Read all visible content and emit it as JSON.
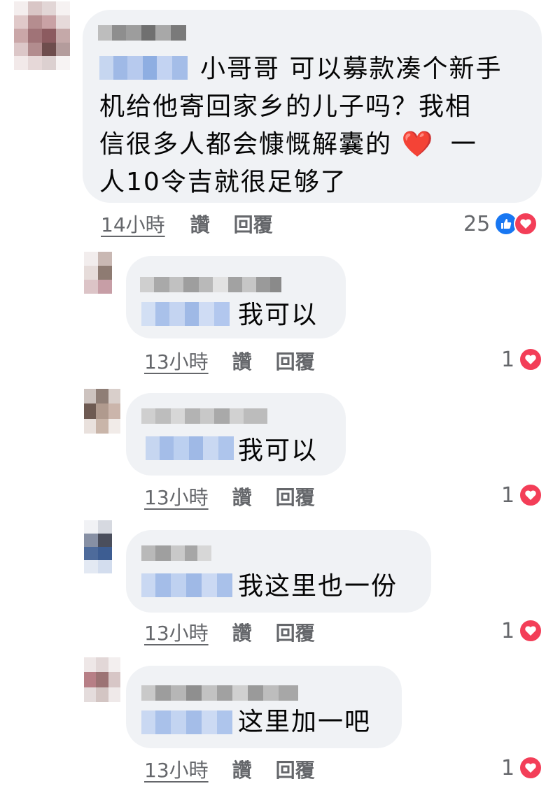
{
  "comments": [
    {
      "text_line1": "小哥哥 可以募款凑个新手",
      "text_line2": "机给他寄回家乡的儿子吗？我相",
      "text_line3": "信很多人都会慷慨解囊的",
      "text_line3_tail": "一",
      "text_line4": "人10令吉就很足够了",
      "emoji": "❤️",
      "time": "14小時",
      "like": "讚",
      "reply": "回覆",
      "reaction_count": "25",
      "reaction_icons": [
        "like-icon",
        "love-icon"
      ]
    },
    {
      "text": "我可以",
      "time": "13小時",
      "like": "讚",
      "reply": "回覆",
      "reaction_count": "1",
      "reaction_icons": [
        "love-icon"
      ]
    },
    {
      "text": "我可以",
      "time": "13小時",
      "like": "讚",
      "reply": "回覆",
      "reaction_count": "1",
      "reaction_icons": [
        "love-icon"
      ]
    },
    {
      "text": "我这里也一份",
      "time": "13小時",
      "like": "讚",
      "reply": "回覆",
      "reaction_count": "1",
      "reaction_icons": [
        "love-icon"
      ]
    },
    {
      "text": "这里加一吧",
      "time": "13小時",
      "like": "讚",
      "reply": "回覆",
      "reaction_count": "1",
      "reaction_icons": [
        "love-icon"
      ]
    }
  ],
  "colors": {
    "bubble": "#f0f2f5",
    "meta_text": "#65676b",
    "like_blue": "#1877f2",
    "love_red": "#f33e58"
  }
}
